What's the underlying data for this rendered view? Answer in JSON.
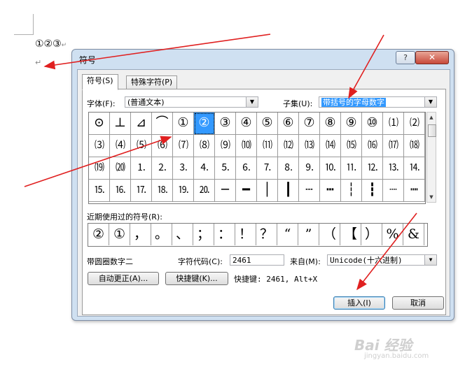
{
  "document": {
    "text": "①②③",
    "para_mark": "↵"
  },
  "dialog": {
    "title": "符号",
    "help_label": "?",
    "close_label": "✕",
    "tabs": [
      {
        "label": "符号(S)"
      },
      {
        "label": "特殊字符(P)"
      }
    ],
    "font_label": "字体(F):",
    "font_value": "(普通文本)",
    "subset_label": "子集(U):",
    "subset_value": "带括号的字母数字",
    "symbols": [
      [
        "⊙",
        "⊥",
        "⊿",
        "⌒",
        "①",
        "②",
        "③",
        "④",
        "⑤",
        "⑥",
        "⑦",
        "⑧",
        "⑨",
        "⑩",
        "⑴",
        "⑵"
      ],
      [
        "⑶",
        "⑷",
        "⑸",
        "⑹",
        "⑺",
        "⑻",
        "⑼",
        "⑽",
        "⑾",
        "⑿",
        "⒀",
        "⒁",
        "⒂",
        "⒃",
        "⒄",
        "⒅"
      ],
      [
        "⒆",
        "⒇",
        "⒈",
        "⒉",
        "⒊",
        "⒋",
        "⒌",
        "⒍",
        "⒎",
        "⒏",
        "⒐",
        "⒑",
        "⒒",
        "⒓",
        "⒔",
        "⒕"
      ],
      [
        "⒖",
        "⒗",
        "⒘",
        "⒙",
        "⒚",
        "⒛",
        "─",
        "━",
        "│",
        "┃",
        "┄",
        "┅",
        "┆",
        "┇",
        "┈",
        "┉"
      ]
    ],
    "recent_label": "近期使用过的符号(R):",
    "recent": [
      "②",
      "①",
      "，",
      "。",
      "、",
      "；",
      "：",
      "！",
      "？",
      "“",
      "”",
      "（",
      "【",
      "）",
      "%",
      "&"
    ],
    "char_name": "带圆圈数字二",
    "char_code_label": "字符代码(C):",
    "char_code_value": "2461",
    "from_label": "来自(M):",
    "from_value": "Unicode(十六进制)",
    "autocorrect_label": "自动更正(A)...",
    "shortcut_key_label": "快捷键(K)...",
    "shortcut_text": "快捷键: 2461, Alt+X",
    "insert_label": "插入(I)",
    "cancel_label": "取消"
  },
  "watermark": {
    "text": "Bai 经验",
    "url": "jingyan.baidu.com"
  },
  "colors": {
    "selection": "#3399ff",
    "annotation_arrow": "#e02020"
  }
}
